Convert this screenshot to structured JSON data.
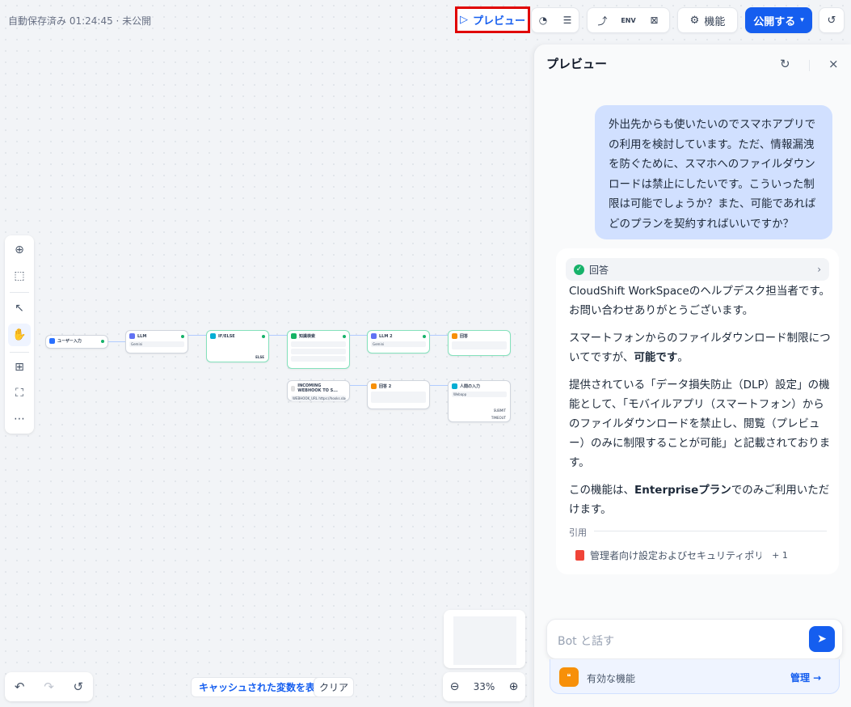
{
  "status": "自動保存済み 01:24:45 · 未公開",
  "toolbar": {
    "preview_label": "プレビュー",
    "features_label": "機能",
    "publish_label": "公開する",
    "env_label": "ENV"
  },
  "canvas": {
    "nodes": {
      "start": "ユーザー入力",
      "llm": "LLM",
      "ifelse": "IF/ELSE",
      "kb": "知識検索",
      "llm2": "LLM 2",
      "answer": "回答",
      "webhook": "INCOMING WEBHOOK TO S...",
      "webhook_row": "WEBHOOK_URL https://hooks.slack...",
      "answer2": "回答 2",
      "human": "人間の入力",
      "human_row": "Webapp",
      "submit": "SUBMIT",
      "timeout": "TIMEOUT",
      "ifelse_else": "ELSE",
      "model": "Gemini"
    },
    "cache_button": "キャッシュされた変数を表示",
    "clear_button": "クリア",
    "zoom": "33%"
  },
  "preview": {
    "title": "プレビュー",
    "user_message": "外出先からも使いたいのでスマホアプリでの利用を検討しています。ただ、情報漏洩を防ぐために、スマホへのファイルダウンロードは禁止にしたいです。こういった制限は可能でしょうか？また、可能であればどのプランを契約すればいいですか？",
    "answer_header": "回答",
    "answer_p1": "CloudShift WorkSpaceのヘルプデスク担当者です。お問い合わせありがとうございます。",
    "answer_p2_a": "スマートフォンからのファイルダウンロード制限についてですが、",
    "answer_p2_b": "可能です",
    "answer_p2_c": "。",
    "answer_p3": "提供されている「データ損失防止（DLP）設定」の機能として、「モバイルアプリ（スマートフォン）からのファイルダウンロードを禁止し、閲覧（プレビュー）のみに制限することが可能」と記載されております。",
    "answer_p4_a": "この機能は、",
    "answer_p4_b": "Enterpriseプラン",
    "answer_p4_c": "でのみご利用いただけます。",
    "citation_label": "引用",
    "citation_item": "管理者向け設定およびセキュリティポリシー...",
    "citation_more": "+ 1",
    "input_placeholder": "Bot と話す",
    "features_text": "有効な機能",
    "manage_label": "管理 →"
  }
}
